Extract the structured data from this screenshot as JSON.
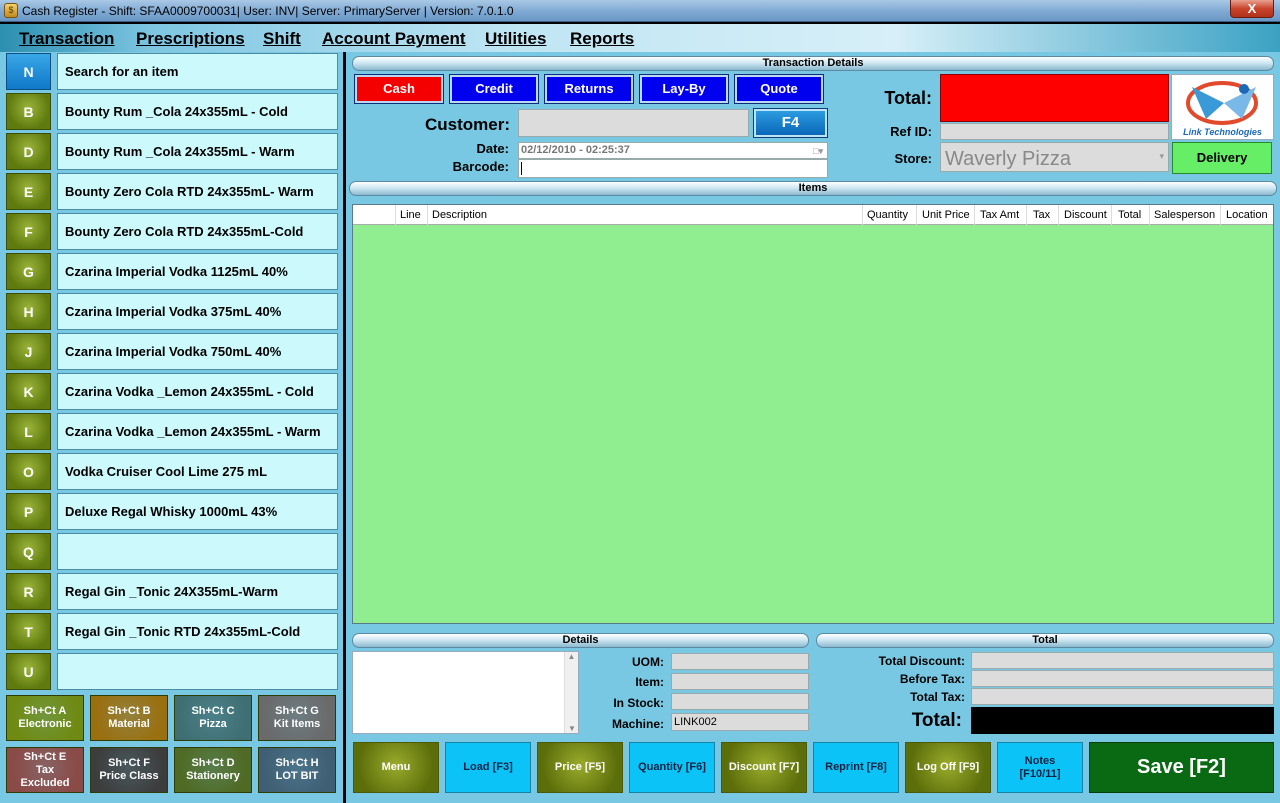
{
  "window": {
    "title": "Cash Register - Shift: SFAA0009700031| User: INV| Server: PrimaryServer | Version: 7.0.1.0",
    "close_label": "X"
  },
  "menu": [
    "Transaction",
    "Prescriptions",
    "Shift",
    "Account Payment",
    "Utilities",
    "Reports"
  ],
  "items_list": [
    {
      "key": "N",
      "label": "Search for an item",
      "selected": true
    },
    {
      "key": "B",
      "label": "Bounty Rum _Cola 24x355mL - Cold"
    },
    {
      "key": "D",
      "label": "Bounty Rum _Cola 24x355mL - Warm"
    },
    {
      "key": "E",
      "label": "Bounty Zero Cola RTD 24x355mL- Warm"
    },
    {
      "key": "F",
      "label": "Bounty Zero Cola RTD 24x355mL-Cold"
    },
    {
      "key": "G",
      "label": "Czarina Imperial Vodka 1125mL 40%"
    },
    {
      "key": "H",
      "label": "Czarina Imperial Vodka 375mL 40%"
    },
    {
      "key": "J",
      "label": "Czarina Imperial Vodka 750mL 40%"
    },
    {
      "key": "K",
      "label": "Czarina Vodka _Lemon 24x355mL - Cold"
    },
    {
      "key": "L",
      "label": "Czarina Vodka _Lemon 24x355mL - Warm"
    },
    {
      "key": "O",
      "label": "Vodka Cruiser Cool Lime 275 mL"
    },
    {
      "key": "P",
      "label": "Deluxe Regal Whisky 1000mL 43%"
    },
    {
      "key": "Q",
      "label": ""
    },
    {
      "key": "R",
      "label": "Regal Gin _Tonic 24X355mL-Warm"
    },
    {
      "key": "T",
      "label": "Regal Gin _Tonic RTD 24x355mL-Cold"
    },
    {
      "key": "U",
      "label": ""
    }
  ],
  "shortcut_buttons": [
    {
      "line1": "Sh+Ct A",
      "line2": "Electronic",
      "line3": "",
      "color": "#6f8a12"
    },
    {
      "line1": "Sh+Ct B",
      "line2": "Material",
      "line3": "",
      "color": "#9a6f10"
    },
    {
      "line1": "Sh+Ct C",
      "line2": "Pizza",
      "line3": "",
      "color": "#3f6f73"
    },
    {
      "line1": "Sh+Ct G",
      "line2": "Kit Items",
      "line3": "",
      "color": "#6a6a6a"
    },
    {
      "line1": "Sh+Ct E",
      "line2": "Tax",
      "line3": "Excluded",
      "color": "#8a4a46"
    },
    {
      "line1": "Sh+Ct F",
      "line2": "Price Class",
      "line3": "",
      "color": "#3d3d3d"
    },
    {
      "line1": "Sh+Ct D",
      "line2": "Stationery",
      "line3": "",
      "color": "#4f6a24"
    },
    {
      "line1": "Sh+Ct H",
      "line2": "LOT BIT",
      "line3": "",
      "color": "#3f5f74"
    }
  ],
  "transaction": {
    "header": "Transaction Details",
    "type_buttons": [
      "Cash",
      "Credit",
      "Returns",
      "Lay-By",
      "Quote"
    ],
    "customer_label": "Customer:",
    "customer_value": "",
    "f4_label": "F4",
    "date_label": "Date:",
    "date_value": "02/12/2010 - 02:25:37",
    "barcode_label": "Barcode:",
    "barcode_value": "",
    "total_label": "Total:",
    "total_value": "",
    "refid_label": "Ref ID:",
    "refid_value": "",
    "store_label": "Store:",
    "store_value": "Waverly Pizza",
    "logo_text": "Link Technologies",
    "delivery_label": "Delivery"
  },
  "items": {
    "header": "Items",
    "columns": [
      "Line",
      "Description",
      "Quantity",
      "Unit Price",
      "Tax Amt",
      "Tax",
      "Discount",
      "Total",
      "Salesperson",
      "Location"
    ],
    "rows": []
  },
  "details": {
    "header": "Details",
    "uom_label": "UOM:",
    "uom_value": "",
    "item_label": "Item:",
    "item_value": "",
    "instock_label": "In Stock:",
    "instock_value": "",
    "machine_label": "Machine:",
    "machine_value": "LINK002"
  },
  "totals": {
    "header": "Total",
    "total_discount_label": "Total Discount:",
    "total_discount_value": "",
    "before_tax_label": "Before Tax:",
    "before_tax_value": "",
    "total_tax_label": "Total Tax:",
    "total_tax_value": "",
    "grand_total_label": "Total:",
    "grand_total_value": ""
  },
  "bottom_buttons": [
    {
      "line1": "Menu",
      "line2": "",
      "style": "olive"
    },
    {
      "line1": "Load [F3]",
      "line2": "",
      "style": "cyan"
    },
    {
      "line1": "Price [F5]",
      "line2": "",
      "style": "olive"
    },
    {
      "line1": "Quantity [F6]",
      "line2": "",
      "style": "cyan"
    },
    {
      "line1": "Discount [F7]",
      "line2": "",
      "style": "olive"
    },
    {
      "line1": "Reprint [F8]",
      "line2": "",
      "style": "cyan"
    },
    {
      "line1": "Log Off [F9]",
      "line2": "",
      "style": "olive"
    },
    {
      "line1": "Notes",
      "line2": "[F10/11]",
      "style": "cyan"
    }
  ],
  "save_label": "Save [F2]",
  "colors": {
    "panel_bg": "#79c8e3",
    "item_bg": "#ccf9fb",
    "grid_bg": "#90ee90",
    "total_box": "#ff0000",
    "save_bg": "#0a6a14"
  }
}
